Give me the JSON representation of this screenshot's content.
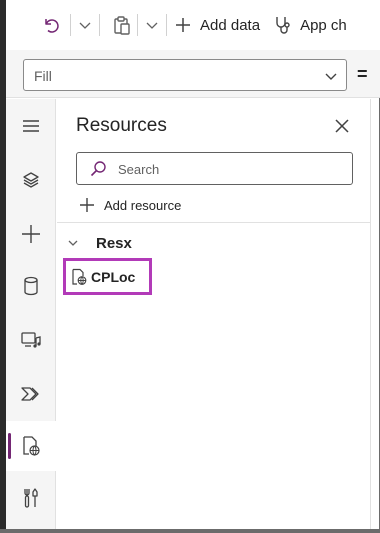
{
  "toolbar": {
    "undo_icon": "undo-icon",
    "paste_icon": "paste-icon",
    "add_data_label": "Add data",
    "app_checker_label": "App ch"
  },
  "formula_bar": {
    "property_value": "Fill",
    "equals": "="
  },
  "rail": {
    "items": [
      {
        "name": "hamburger-menu",
        "icon": "hamburger-icon"
      },
      {
        "name": "tree-view",
        "icon": "layers-icon"
      },
      {
        "name": "insert",
        "icon": "plus-icon"
      },
      {
        "name": "data",
        "icon": "database-icon"
      },
      {
        "name": "media",
        "icon": "media-icon"
      },
      {
        "name": "power-automate",
        "icon": "flow-icon"
      },
      {
        "name": "resources",
        "icon": "globe-document-icon",
        "active": true
      },
      {
        "name": "advanced-tools",
        "icon": "tools-icon"
      }
    ],
    "active_color": "#742774"
  },
  "pane": {
    "title": "Resources",
    "search_placeholder": "Search",
    "add_resource_label": "Add resource",
    "group_label": "Resx",
    "resource_item_label": "CPLoc",
    "highlight_color": "#b23ab8"
  }
}
